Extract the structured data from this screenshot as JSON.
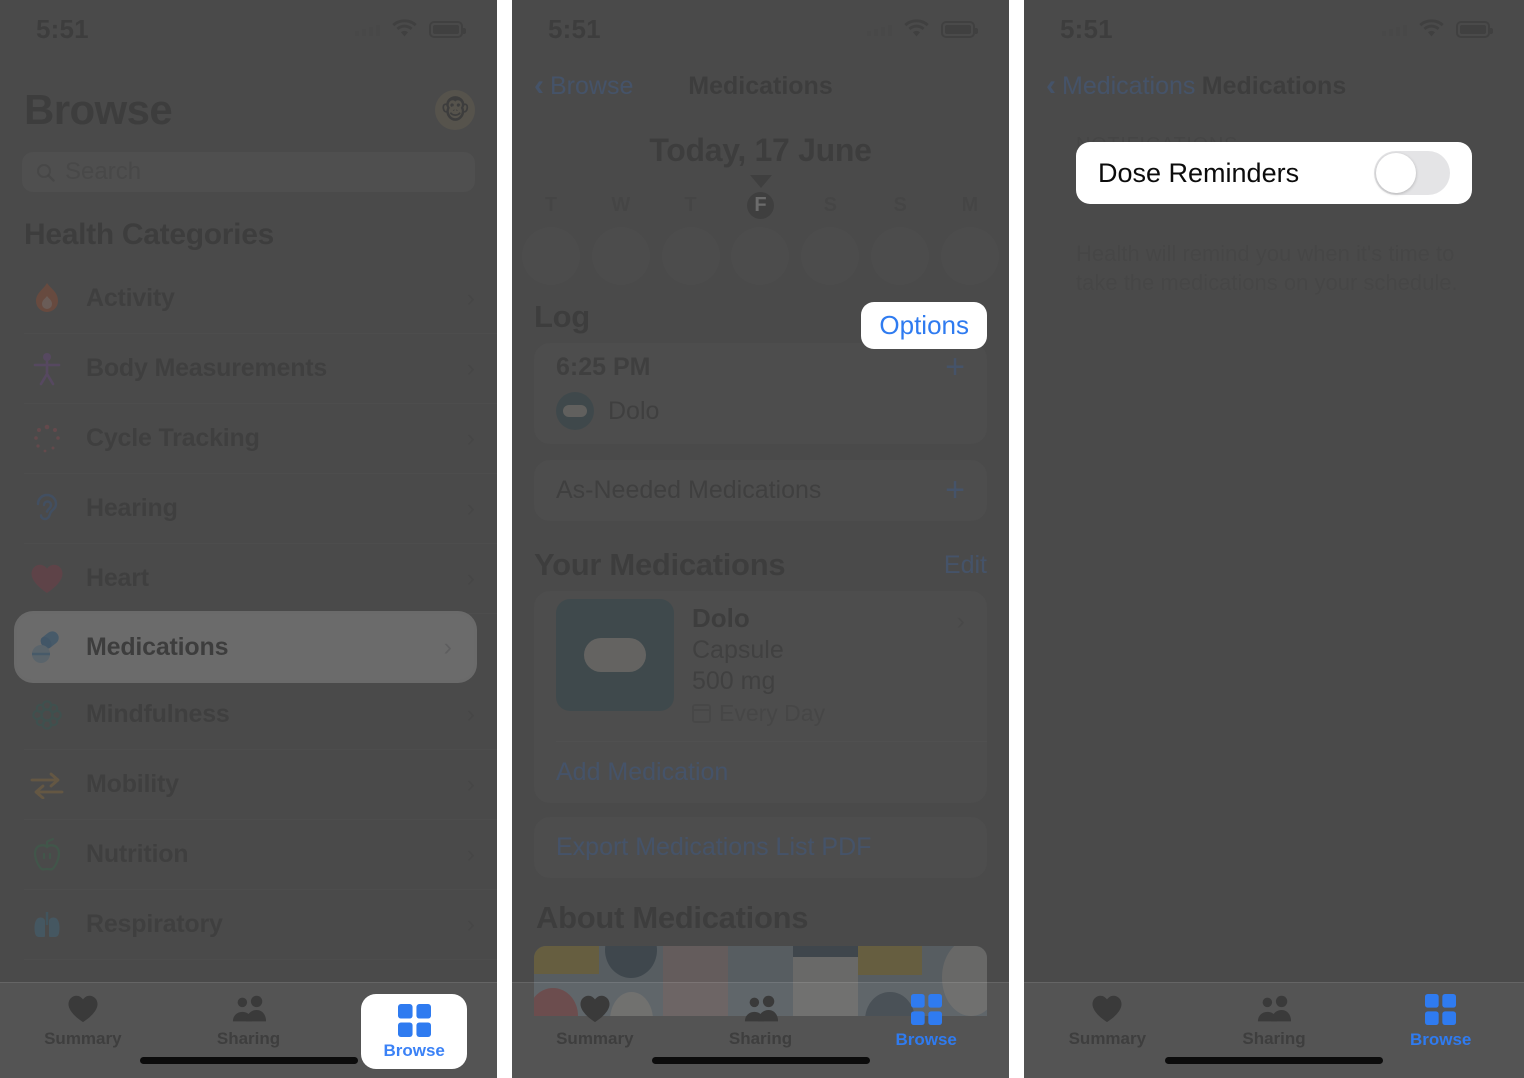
{
  "meta": {
    "accent_blue": "#2f7bf0",
    "dim_overlay": "#4a4a4a",
    "highlight_white": "#ffffff"
  },
  "status_bar": {
    "time": "5:51",
    "wifi_icon": "wifi-icon",
    "battery_icon": "battery-icon",
    "signal_icon": "cellular-signal-icon"
  },
  "panel1": {
    "title": "Browse",
    "avatar_icon": "profile-avatar",
    "search": {
      "placeholder": "Search",
      "icon": "search-icon"
    },
    "section_title": "Health Categories",
    "categories": [
      {
        "label": "Activity",
        "icon": "activity-flame-icon",
        "highlighted": false
      },
      {
        "label": "Body Measurements",
        "icon": "body-measurements-icon",
        "highlighted": false
      },
      {
        "label": "Cycle Tracking",
        "icon": "cycle-tracking-icon",
        "highlighted": false
      },
      {
        "label": "Hearing",
        "icon": "hearing-ear-icon",
        "highlighted": false
      },
      {
        "label": "Heart",
        "icon": "heart-icon",
        "highlighted": false
      },
      {
        "label": "Medications",
        "icon": "medications-pills-icon",
        "highlighted": true
      },
      {
        "label": "Mindfulness",
        "icon": "mindfulness-icon",
        "highlighted": false
      },
      {
        "label": "Mobility",
        "icon": "mobility-arrows-icon",
        "highlighted": false
      },
      {
        "label": "Nutrition",
        "icon": "nutrition-apple-icon",
        "highlighted": false
      },
      {
        "label": "Respiratory",
        "icon": "respiratory-lungs-icon",
        "highlighted": false
      }
    ],
    "chevron": "›",
    "tabs": [
      {
        "label": "Summary",
        "icon": "heart-tab-icon",
        "active": false,
        "highlighted": false
      },
      {
        "label": "Sharing",
        "icon": "sharing-people-icon",
        "active": false,
        "highlighted": false
      },
      {
        "label": "Browse",
        "icon": "browse-grid-icon",
        "active": true,
        "highlighted": true
      }
    ]
  },
  "panel2": {
    "nav": {
      "back_label": "Browse",
      "title": "Medications",
      "back_icon": "chevron-left-icon"
    },
    "date_header": "Today, 17 June",
    "date_caret_icon": "caret-down-icon",
    "days": [
      {
        "letter": "T",
        "today": false
      },
      {
        "letter": "W",
        "today": false
      },
      {
        "letter": "T",
        "today": false
      },
      {
        "letter": "F",
        "today": true
      },
      {
        "letter": "S",
        "today": false
      },
      {
        "letter": "S",
        "today": false
      },
      {
        "letter": "M",
        "today": false
      }
    ],
    "log": {
      "title": "Log",
      "options_label": "Options",
      "entry_time": "6:25 PM",
      "entry_add_icon": "plus-icon",
      "entry_med": "Dolo",
      "entry_med_icon": "capsule-icon",
      "as_needed_label": "As-Needed Medications",
      "as_needed_add_icon": "plus-icon"
    },
    "your_meds": {
      "title": "Your Medications",
      "edit_label": "Edit",
      "item": {
        "name": "Dolo",
        "form": "Capsule",
        "dose": "500 mg",
        "frequency": "Every Day",
        "frequency_icon": "calendar-icon",
        "thumb_icon": "capsule-thumbnail",
        "chevron": "›"
      },
      "add_label": "Add Medication",
      "export_label": "Export Medications List PDF"
    },
    "about": {
      "title": "About Medications"
    },
    "tabs": [
      {
        "label": "Summary",
        "icon": "heart-tab-icon",
        "active": false
      },
      {
        "label": "Sharing",
        "icon": "sharing-people-icon",
        "active": false
      },
      {
        "label": "Browse",
        "icon": "browse-grid-icon",
        "active": true
      }
    ]
  },
  "panel3": {
    "nav": {
      "back_label": "Medications",
      "title": "Medications",
      "back_icon": "chevron-left-icon"
    },
    "group_label": "NOTIFICATIONS",
    "toggle": {
      "label": "Dose Reminders",
      "state": "off"
    },
    "footer_note": "Health will remind you when it's time to take the medications on your schedule.",
    "tabs": [
      {
        "label": "Summary",
        "icon": "heart-tab-icon",
        "active": false
      },
      {
        "label": "Sharing",
        "icon": "sharing-people-icon",
        "active": false
      },
      {
        "label": "Browse",
        "icon": "browse-grid-icon",
        "active": true
      }
    ]
  }
}
